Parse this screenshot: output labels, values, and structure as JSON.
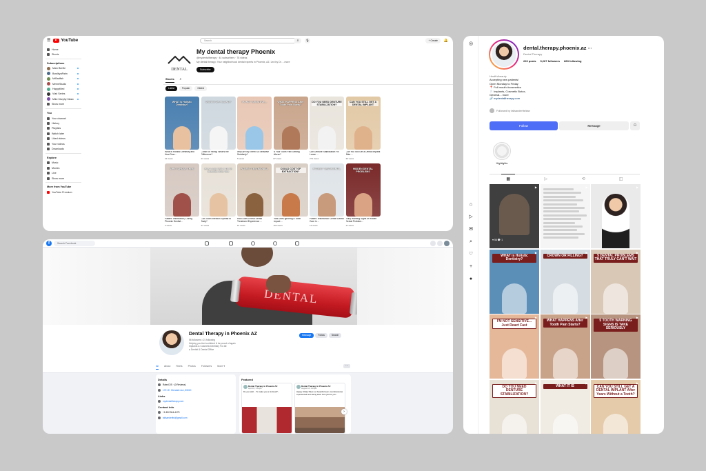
{
  "youtube": {
    "logo": "YouTube",
    "search_placeholder": "Search",
    "create": "+ Create",
    "sidebar": {
      "main": [
        "Home",
        "Shorts"
      ],
      "subs_heading": "Subscriptions",
      "subs": [
        {
          "name": "Marc Benfie",
          "color": "#8a6a4a"
        },
        {
          "name": "BowlbyaPalm",
          "color": "#4a6a8a"
        },
        {
          "name": "MrBadfish",
          "color": "#6a8a4a"
        },
        {
          "name": "MemeStudio",
          "color": "#aa4a4a"
        },
        {
          "name": "HappyMed",
          "color": "#4aaa8a"
        },
        {
          "name": "Vlad Series",
          "color": "#333333"
        },
        {
          "name": "Mike Murphy Music",
          "color": "#7a4aaa"
        }
      ],
      "show_more_1": "Show more",
      "you_heading": "You",
      "you": [
        "Your channel",
        "History",
        "Playlists",
        "Watch later",
        "Liked videos",
        "Your videos",
        "Downloads"
      ],
      "explore_heading": "Explore",
      "explore": [
        "Music",
        "Movies",
        "Live",
        "Show more"
      ],
      "more_heading": "More from YouTube",
      "more": [
        "YouTube Premium"
      ]
    },
    "channel": {
      "name": "My dental therapy Phoenix",
      "handle_meta": "@mydentaltherapy · 44 subscribers · 78 videos",
      "description": "My dental therapy: Your neighborhood dental experts in Phoenix, AZ. Led by Dr. ...more",
      "subscribe": "Subscribe",
      "logo_text": "DENTAL"
    },
    "tabs": [
      "Shorts"
    ],
    "chips": [
      "Latest",
      "Popular",
      "Oldest"
    ],
    "shorts": [
      {
        "cap": "WHAT is Holistic Dentistry?",
        "title": "What is Holistic Dentistry and How Dow...",
        "views": "22 views",
        "bg": "#4a7fb0",
        "face": "#e7c1a0",
        "dark": false
      },
      {
        "cap": "CROWN OR FILLING?",
        "title": "Crown or Filling: What's the Difference?",
        "views": "21 views",
        "bg": "#cfd8df",
        "face": "#f5f5f5",
        "dark": false
      },
      {
        "cap": "I'M NOT SENSITIVE...",
        "title": "Why Are My Teeth So Sensitive Suddenly?",
        "views": "5 views",
        "bg": "#e8c7b5",
        "face": "#9ac7e8",
        "dark": false
      },
      {
        "cap": "WHAT HAPPENS After Tooth Pain Starts?",
        "title": "Is Your Tooth Pain Getting Worse?",
        "views": "87 views",
        "bg": "#c9a58c",
        "face": "#b07a5a",
        "dark": false
      },
      {
        "cap": "DO YOU NEED DENTURE STABILIZATION?",
        "title": "Can Denture Stabilization Fix Loose ...",
        "views": "273 views",
        "bg": "#e9e4dc",
        "face": "#f2f2f2",
        "dark": true
      },
      {
        "cap": "CAN YOU STILL GET A DENTAL IMPLANT",
        "title": "Can You Still Get a Dental Implant After ...",
        "views": "36 views",
        "bg": "#e2c9a6",
        "face": "#e0b28c",
        "dark": true
      },
      {
        "cap": "WHY I CHOSE THEM",
        "title": "Patient Testimonial | Caring Phoenix Dentist...",
        "views": "3 views",
        "bg": "#d6c9c2",
        "face": "#a0524a",
        "dark": false
      },
      {
        "cap": "How Long Until a Tooth Infection Kills You",
        "title": "Can Tooth Infection Spread to Body?",
        "views": "47 views",
        "bg": "#e7e1d8",
        "face": "#e6c4a3",
        "dark": false
      },
      {
        "cap": "PATIENT TESTIMONIAL",
        "title": "How Does a Real Dental Treatment Experience ...",
        "views": "67 views",
        "bg": "#d8c8b8",
        "face": "#8a6240",
        "dark": false
      },
      {
        "cap": "COULD COST OF EXTRACTION?",
        "title": "How Does Ignoring a Tooth Impact ...",
        "views": "164 views",
        "bg": "#d9cfc6",
        "face": "#c97a4a",
        "dark": true
      },
      {
        "cap": "PATIENT TESTIMONIAL",
        "title": "Patient Testimonial: Gentle Dental Care in ...",
        "views": "14 views",
        "bg": "#dfe4e8",
        "face": "#c79b7c",
        "dark": false
      },
      {
        "cap": "HIDDEN DENTAL PROBLEMS",
        "title": "Early Warning Signs of Hidden Dental Problem...",
        "views": "11 views",
        "bg": "#7a2a2a",
        "face": "#d9a384",
        "dark": false
      }
    ]
  },
  "facebook": {
    "search_placeholder": "Search Facebook",
    "cover_brand": "DENTAL",
    "page_name": "Dental Therapy in Phoenix AZ",
    "meta_lines": [
      "56 followers • 21 following",
      "Helping you feel confident & be proud of again",
      "Implants & Cosmetic Dentistry For All",
      "● Dentist & Dental Office"
    ],
    "buttons": [
      "Message",
      "Follow",
      "Search"
    ],
    "tabs": [
      "All",
      "About",
      "Reels",
      "Photos",
      "Followers",
      "More ▾"
    ],
    "details_heading": "Details",
    "details": [
      "Rated 2/5 · (0 Reviews)",
      "1701 E. Glendale Ave, 85020"
    ],
    "links_heading": "Links",
    "link": "mydentaltherapy.com",
    "contact_heading": "Contact info",
    "phone": "+1 602-944-4173",
    "email": "talisanderitsi@gmail.com",
    "featured_heading": "Featured",
    "posts": [
      {
        "name": "Dental Therapy in Phoenix AZ",
        "date": "April 15, 3:51pm",
        "text": "Do you wish... To make you an invisual?..."
      },
      {
        "name": "Dental Therapy in Phoenix AZ",
        "date": "August 16, 2:14pm",
        "text": "Happy Friday! Meet our beautiful team. A professional, experienced and caring team here just for you..."
      }
    ]
  },
  "instagram": {
    "username": "dental.therapy.phoenix.az",
    "category": "Dental Therapy",
    "posts": "220 posts",
    "followers": "9,267 followers",
    "following": "863 following",
    "bio_label": "Health/beauty",
    "bio": [
      "Accepting new patients!",
      "Open Monday to Friday",
      "📍 Full mouth #cosmetics",
      "🦷 Implants, Cosmetic Botox,",
      "General... more"
    ],
    "bio_link": "mydentaltherapy.com",
    "followed_by": "Followed by talisanderitshian",
    "follow": "Follow",
    "message": "Message",
    "highlights": "Highlights",
    "grid": [
      {
        "cap": "",
        "bg": "#3f3f3f",
        "style": "dark",
        "likes": "♥ 56   💬 1"
      },
      {
        "cap": "",
        "bg": "#f5f5f5",
        "style": "text"
      },
      {
        "cap": "",
        "bg": "#eaeaea",
        "style": "person"
      },
      {
        "cap": "WHAT is Holistic Dentistry?",
        "bg": "#5c8fb8",
        "style": "rb"
      },
      {
        "cap": "CROWN OR FILLING?",
        "bg": "#d5dde3",
        "style": "rb"
      },
      {
        "cap": "5 DENTAL PROBLEMS THAT TRULY CAN'T WAIT",
        "bg": "#d9c8b6",
        "style": "rb"
      },
      {
        "cap": "I'M NOT SENSITIVE... Just React Fast",
        "bg": "#e6b89a",
        "style": "wb"
      },
      {
        "cap": "WHAT HAPPENS After Tooth Pain Starts?",
        "bg": "#c9a28a",
        "style": "rb"
      },
      {
        "cap": "5 TOOTH WARNING SIGNS IS TAKE SERIOUSLY",
        "bg": "#b79480",
        "style": "rb"
      },
      {
        "cap": "DO YOU NEED DENTURE STABILIZATION?",
        "bg": "#e8e1d6",
        "style": "wb"
      },
      {
        "cap": "WHAT IT IS",
        "bg": "#f0ebe3",
        "style": "rb"
      },
      {
        "cap": "CAN YOU STILL GET A DENTAL IMPLANT After Years Without a Tooth?",
        "bg": "#e5cba9",
        "style": "wb"
      }
    ]
  }
}
